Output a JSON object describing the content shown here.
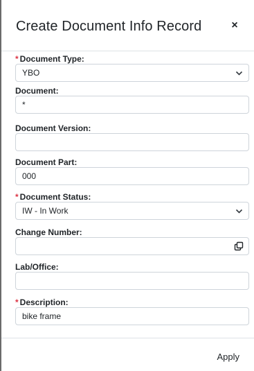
{
  "dialog": {
    "title": "Create Document Info Record",
    "close_label": "×",
    "required_mark": "*",
    "fields": {
      "document_type": {
        "label": "Document Type:",
        "value": "YBO",
        "required": true
      },
      "document": {
        "label": "Document:",
        "value": "*",
        "required": false
      },
      "document_version": {
        "label": "Document Version:",
        "value": "",
        "required": false
      },
      "document_part": {
        "label": "Document Part:",
        "value": "000",
        "required": false
      },
      "document_status": {
        "label": "Document Status:",
        "value": "IW - In Work",
        "required": true
      },
      "change_number": {
        "label": "Change Number:",
        "value": "",
        "required": false
      },
      "lab_office": {
        "label": "Lab/Office:",
        "value": "",
        "required": false
      },
      "description": {
        "label": "Description:",
        "value": "bike frame",
        "required": true
      }
    },
    "footer": {
      "apply_label": "Apply"
    }
  }
}
